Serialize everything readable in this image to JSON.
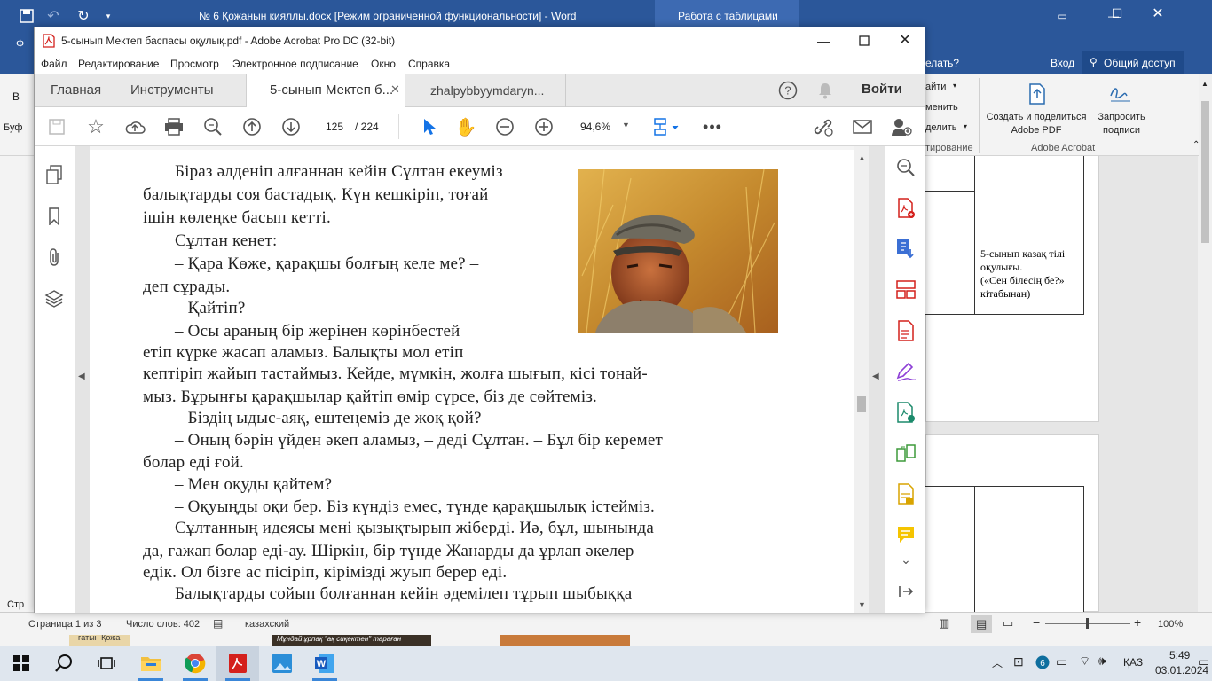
{
  "word": {
    "title": "№ 6 Қожанын кияллы.docx [Режим ограниченной функциональности] - Word",
    "context_tab": "Работа с таблицами",
    "tell_me": "елать?",
    "login": "Вход",
    "share": "Общий доступ",
    "ribbon": {
      "create_share_pdf": "Создать и поделиться Adobe PDF",
      "request_signatures": "Запросить подписи",
      "group_adobe": "Adobe Acrobat",
      "frag1": "айти",
      "frag2": "менить",
      "frag3": "делить",
      "frag4": "тирование",
      "left1": "В",
      "left2": "Буф"
    },
    "doc_cell_text": [
      "5-сынып қазақ тілі",
      "оқулығы.",
      "(«Сен білесің бе?»",
      "кітабынан)"
    ],
    "status": {
      "page": "Страница 1 из 3",
      "words": "Число слов: 402",
      "language": "казахский",
      "zoom": "100%",
      "left_str": "Стр"
    }
  },
  "acrobat": {
    "title": "5-сынып Мектеп баспасы оқулық.pdf - Adobe Acrobat Pro DC (32-bit)",
    "menu": [
      "Файл",
      "Редактирование",
      "Просмотр",
      "Электронное подписание",
      "Окно",
      "Справка"
    ],
    "tabs": {
      "home": "Главная",
      "tools": "Инструменты",
      "doc1": "5-сынып Мектеп б...",
      "doc2": "zhalpybbyymdaryn..."
    },
    "signin": "Войти",
    "page_current": "125",
    "page_total": "/ 224",
    "zoom": "94,6%"
  },
  "pdf_text": [
    "Біраз әлденіп алғаннан кейін Сұлтан екеуміз",
    "балықтарды соя бастадық. Күн кешкіріп, тоғай",
    "ішін көлеңке басып кетті.",
    "Сұлтан кенет:",
    "– Қара Көже, қарақшы болғың келе ме? –",
    "деп сұрады.",
    "– Қайтіп?",
    "– Осы араның бір жерінен көрінбестей",
    "етіп күрке жасап аламыз. Балықты мол етіп",
    "кептіріп жайып тастаймыз. Кейде, мүмкін, жолға шығып, кісі тонай-",
    "мыз. Бұрынғы қарақшылар қайтіп өмір сүрсе, біз де сөйтеміз.",
    "– Біздің ыдыс-аяқ, ештеңеміз де жоқ қой?",
    "– Оның бәрін үйден әкеп аламыз, – деді Сұлтан. – Бұл бір керемет",
    "болар еді ғой.",
    "– Мен оқуды қайтем?",
    "– Оқуыңды оқи бер. Біз күндіз емес, түнде қарақшылық істейміз.",
    "Сұлтанның идеясы мені қызықтырып жіберді. Иә, бұл, шынында",
    "да, ғажап болар еді-ау. Шіркін, бір түнде Жанарды да ұрлап әкелер",
    "едік. Ол бізге ас пісіріп, кірімізді жуып берер еді.",
    "Балықтарды сойып болғаннан кейін әдемілеп тұрып шыбыққа"
  ],
  "taskbar": {
    "time": "5:49",
    "date": "03.01.2024",
    "lang": "ҚАЗ",
    "thumb1": "Мұндай ұрпақ \"ақ сиқектен\" тараған",
    "thumb_left": "ғатын Қожа"
  },
  "colors": {
    "word_blue": "#2b579a",
    "acrobat_red": "#d4201c",
    "pointer_blue": "#1473e6"
  }
}
